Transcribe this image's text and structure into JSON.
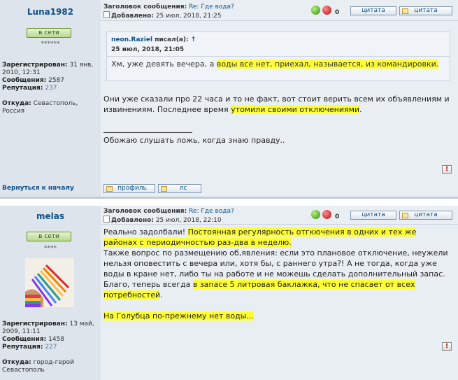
{
  "post1": {
    "username": "Luna1982",
    "online_label": "в сети",
    "stars": "******",
    "registered_label": "Зарегистрирован:",
    "registered_value": "31 янв, 2010, 12:31",
    "messages_label": "Сообщения:",
    "messages_value": "2587",
    "reputation_label": "Репутация:",
    "reputation_value": "237",
    "location_label": "Откуда:",
    "location_value": "Севастополь, Россия",
    "subject_label": "Заголовок сообщения:",
    "subject_value": "Re: Где вода?",
    "added_label": "Добавлено:",
    "added_value": "25 июл, 2018, 21:25",
    "karma": "0",
    "quote_button": "цитата",
    "quote_button2": "цитата",
    "quote": {
      "author": "neon.Raziel",
      "wrote": "писал(а):",
      "arrow": "↑",
      "date": "25 июл, 2018, 21:05",
      "text_a": "Хм, уже девять вечера, а ",
      "text_hl": "воды все нет, приехал, называется, из командировки.",
      "text_b": ""
    },
    "body_a": "Они уже сказали про 22 часа и то не факт, вот стоит верить всем их объявлениям и извинениям. Последнее время ",
    "body_hl": "утомили своими отключениями",
    "body_b": ".",
    "signature": "Обожаю слушать ложь, когда знаю правду..",
    "back_to_top": "Вернуться к началу",
    "profile_button": "профиль",
    "pm_button": "лс"
  },
  "post2": {
    "username": "melas",
    "online_label": "в сети",
    "stars": "****",
    "registered_label": "Зарегистрирован:",
    "registered_value": "13 май, 2009, 11:11",
    "messages_label": "Сообщения:",
    "messages_value": "1458",
    "reputation_label": "Репутация:",
    "reputation_value": "227",
    "location_label": "Откуда:",
    "location_value": "город-герой Севастополь",
    "subject_label": "Заголовок сообщения:",
    "subject_value": "Re: Где вода?",
    "added_label": "Добавлено:",
    "added_value": "25 июл, 2018, 22:10",
    "karma": "0",
    "quote_button": "цитата",
    "quote_button2": "цитата",
    "p1_a": "Реально задолбали! ",
    "p1_hl": "Постоянная регулярность отгкючения в одних и тех же районах с периодичностью раз-два в неделю.",
    "p2_a": "Также вопрос по размещению об,явления: если это плановое отключение, неужели нельзя оповестить с вечера или, хотя бы, с раннего утра?! А не тогда, когда уже воды в кране нет, либо ты на работе и не можешь сделать дополнительный запас. Благо, теперь всегда ",
    "p2_hl": "в запасе 5 литровая баклажка, что не спасает от всех потребностей",
    "p2_b": ".",
    "p3_hl": "На Голубца по-прежнему нет воды...",
    "colors": {
      "highlight": "#ffff33",
      "link": "#105289",
      "left_panel": "#dde4ec",
      "right_panel": "#e9eef3"
    }
  }
}
